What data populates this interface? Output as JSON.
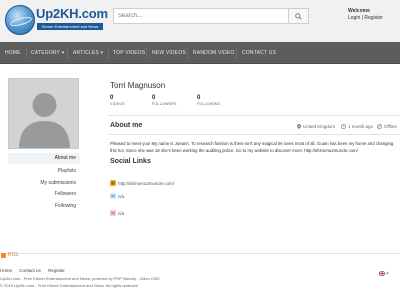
{
  "header": {
    "logo_text": "Up2KH.com",
    "logo_tagline": "Khmer Entertainment and News",
    "search_placeholder": "Search...",
    "welcome": "Welcome",
    "login": "Login",
    "separator": "|",
    "register": "Register"
  },
  "nav": {
    "items": [
      "HOME",
      "CATEGORY ▾",
      "ARTICLES ▾",
      "TOP VIDEOS",
      "NEW VIDEOS",
      "RANDOM VIDEO",
      "CONTACT US"
    ],
    "bg_color": "#5d5d5d"
  },
  "profile": {
    "name": "Torri Magnuson",
    "stats": [
      {
        "value": "0",
        "label": "VIDEOS"
      },
      {
        "value": "0",
        "label": "FOLLOWERS"
      },
      {
        "value": "0",
        "label": "FOLLOWING"
      }
    ]
  },
  "sidebar": {
    "items": [
      "About me",
      "Playlists",
      "My submissions",
      "Followers",
      "Following"
    ]
  },
  "about": {
    "title": "About me",
    "location": "United Kingdom",
    "last_seen": "1 month ago",
    "status": "Offline",
    "bio": "Pleased to meet you! My name is Joeann. To research fashion is there isn't any magical let loves most of all. Guam has been my home and changing this hoi. Since she was 18 she's been working the auditing police. Go to my website to discover more: http://shirsenu2muscle.com/"
  },
  "social": {
    "title": "Social Links",
    "links": [
      {
        "icon": "website-icon",
        "text": "http://shirsenu2muscle.com/"
      },
      {
        "icon": "twitter-icon",
        "text": "n/a"
      },
      {
        "icon": "facebook-icon",
        "text": "n/a"
      }
    ]
  },
  "footer": {
    "rss": "RSS",
    "links": [
      "Home",
      "Contact us",
      "Register"
    ],
    "line1": "Up2kh.com - Free Khmer Entertainment and News, powered by PHP Melody - Video CMS",
    "line2": "© 2015 Up2kh.com - Free Khmer Entertainment and News. All rights reserved",
    "flag_icon": "uk-flag-icon"
  },
  "colors": {
    "brand_blue": "#1b5a96",
    "nav_bg": "#5d5d5d",
    "rss_orange": "#f08a24"
  }
}
